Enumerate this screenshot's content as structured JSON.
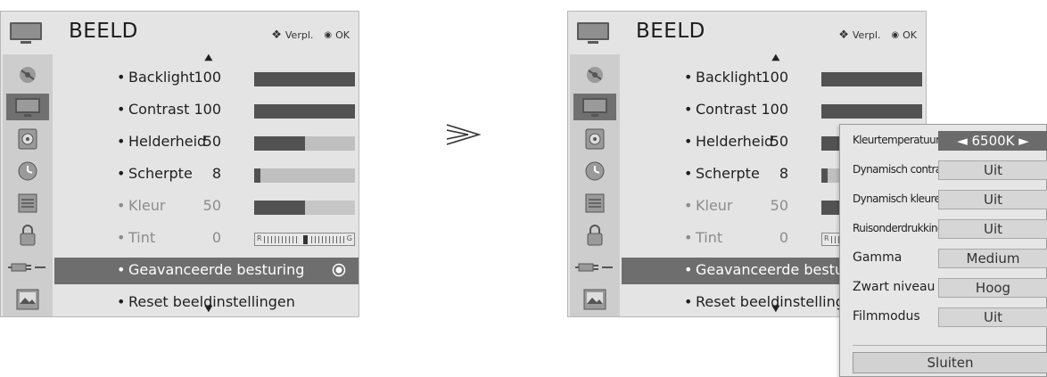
{
  "header": {
    "title": "BEELD",
    "hint_move": "Verpl.",
    "hint_ok": "OK",
    "move_icon": "◀▶",
    "ok_icon": "◉"
  },
  "sidebar": {
    "items": [
      "satellite-dish-icon",
      "tv-screen-icon",
      "speaker-icon",
      "clock-icon",
      "lock-list-icon",
      "padlock-icon",
      "plug-icon",
      "photo-icon"
    ],
    "active_index": 1
  },
  "menu": {
    "scroll_up": "▲",
    "scroll_down": "▼",
    "bullet": "•",
    "rows": [
      {
        "label": "Backlight",
        "value": "100",
        "level": 1.0
      },
      {
        "label": "Contrast",
        "value": "100",
        "level": 1.0
      },
      {
        "label": "Helderheid",
        "value": "50",
        "level": 0.5
      },
      {
        "label": "Scherpte",
        "value": "8",
        "level": 0.06
      },
      {
        "label": "Kleur",
        "value": "50",
        "level": 0.5,
        "dim": true
      },
      {
        "label": "Tint",
        "value": "0",
        "dim": true,
        "tint_left": "R",
        "tint_right": "G"
      },
      {
        "label": "Geavanceerde besturing",
        "highlight": true
      },
      {
        "label": "Reset beeldinstellingen"
      }
    ]
  },
  "transition_arrow": "≫",
  "popup": {
    "rows": [
      {
        "label": "Kleurtemperatuur",
        "value": "◄  6500K  ►",
        "selected": true,
        "size": "small"
      },
      {
        "label": "Dynamisch contrast",
        "value": "Uit",
        "size": "small"
      },
      {
        "label": "Dynamisch kleuren",
        "value": "Uit",
        "size": "small"
      },
      {
        "label": "Ruisonderdrukking",
        "value": "Uit",
        "size": "small"
      },
      {
        "label": "Gamma",
        "value": "Medium",
        "size": "big"
      },
      {
        "label": "Zwart niveau",
        "value": "Hoog",
        "size": "big"
      },
      {
        "label": "Filmmodus",
        "value": "Uit",
        "size": "big"
      }
    ],
    "close_label": "Sluiten"
  },
  "colors": {
    "panel_bg": "#e4e4e4",
    "highlight": "#6e6e6e",
    "bar_fill": "#525252",
    "bar_track": "#bfbfbf"
  }
}
